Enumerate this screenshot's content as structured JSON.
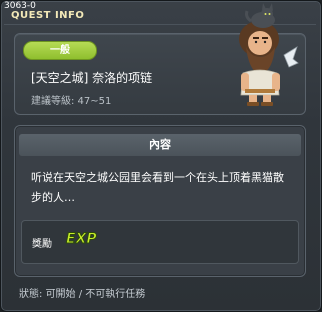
{
  "window": {
    "quest_id": "3063-0",
    "title": "QUEST INFO"
  },
  "quest": {
    "category": "一般",
    "name": "[天空之城] 奈洛的项链",
    "level_range": "建議等級: 47~51"
  },
  "content": {
    "header": "內容",
    "description": "听说在天空之城公园里会看到一个在头上顶着黑猫散步的人…",
    "reward_label": "獎勵",
    "reward_icon_text": "EXP"
  },
  "status": {
    "text": "狀態: 可開始 / 不可執行任務"
  },
  "icons": {
    "npc": "npc-portrait-icon",
    "exp": "exp-reward-icon"
  }
}
